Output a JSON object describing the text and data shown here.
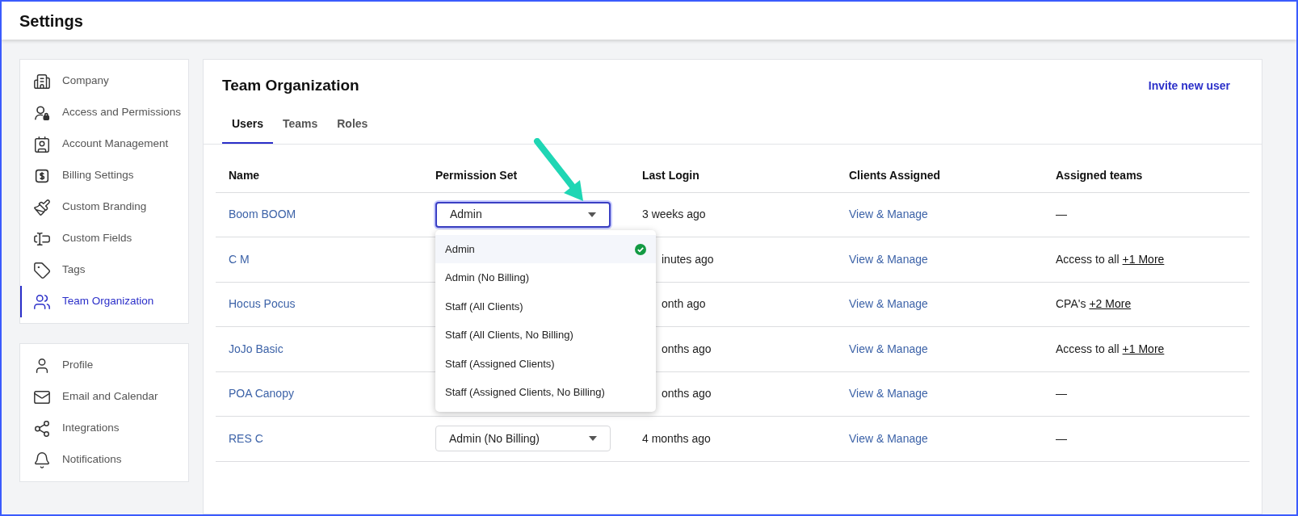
{
  "header": {
    "title": "Settings"
  },
  "sidebar": {
    "groups": [
      [
        {
          "label": "Company",
          "selected": false
        },
        {
          "label": "Access and Permissions",
          "selected": false
        },
        {
          "label": "Account Management",
          "selected": false
        },
        {
          "label": "Billing Settings",
          "selected": false
        },
        {
          "label": "Custom Branding",
          "selected": false
        },
        {
          "label": "Custom Fields",
          "selected": false
        },
        {
          "label": "Tags",
          "selected": false
        },
        {
          "label": "Team Organization",
          "selected": true
        }
      ],
      [
        {
          "label": "Profile",
          "selected": false
        },
        {
          "label": "Email and Calendar",
          "selected": false
        },
        {
          "label": "Integrations",
          "selected": false
        },
        {
          "label": "Notifications",
          "selected": false
        }
      ]
    ]
  },
  "main": {
    "title": "Team Organization",
    "action": "Invite new user",
    "tabs": [
      {
        "label": "Users",
        "selected": true
      },
      {
        "label": "Teams",
        "selected": false
      },
      {
        "label": "Roles",
        "selected": false
      }
    ],
    "table": {
      "columns": [
        "Name",
        "Permission Set",
        "Last Login",
        "Clients Assigned",
        "Assigned teams"
      ],
      "rows": [
        {
          "name": "Boom BOOM",
          "permission": {
            "value": "Admin",
            "expanded": true
          },
          "last_login": "3 weeks ago",
          "clients": "View & Manage",
          "teams": "—"
        },
        {
          "name": "C M",
          "last_login": "inutes ago",
          "clients": "View & Manage",
          "teams": "Access to all",
          "more": "+1 More"
        },
        {
          "name": "Hocus Pocus",
          "last_login": "onth ago",
          "clients": "View & Manage",
          "teams": "CPA's",
          "more": "+2 More"
        },
        {
          "name": "JoJo Basic",
          "last_login": "onths ago",
          "clients": "View & Manage",
          "teams": "Access to all",
          "more": "+1 More"
        },
        {
          "name": "POA Canopy",
          "last_login": "onths ago",
          "clients": "View & Manage",
          "teams": "—"
        },
        {
          "name": "RES C",
          "permission": {
            "value": "Admin (No Billing)",
            "expanded": false
          },
          "last_login": "4 months ago",
          "clients": "View & Manage",
          "teams": "—"
        }
      ]
    },
    "dropdown": {
      "options": [
        {
          "label": "Admin",
          "selected": true
        },
        {
          "label": "Admin (No Billing)",
          "selected": false
        },
        {
          "label": "Staff (All Clients)",
          "selected": false
        },
        {
          "label": "Staff (All Clients, No Billing)",
          "selected": false
        },
        {
          "label": "Staff (Assigned Clients)",
          "selected": false
        },
        {
          "label": "Staff (Assigned Clients, No Billing)",
          "selected": false
        }
      ]
    }
  }
}
